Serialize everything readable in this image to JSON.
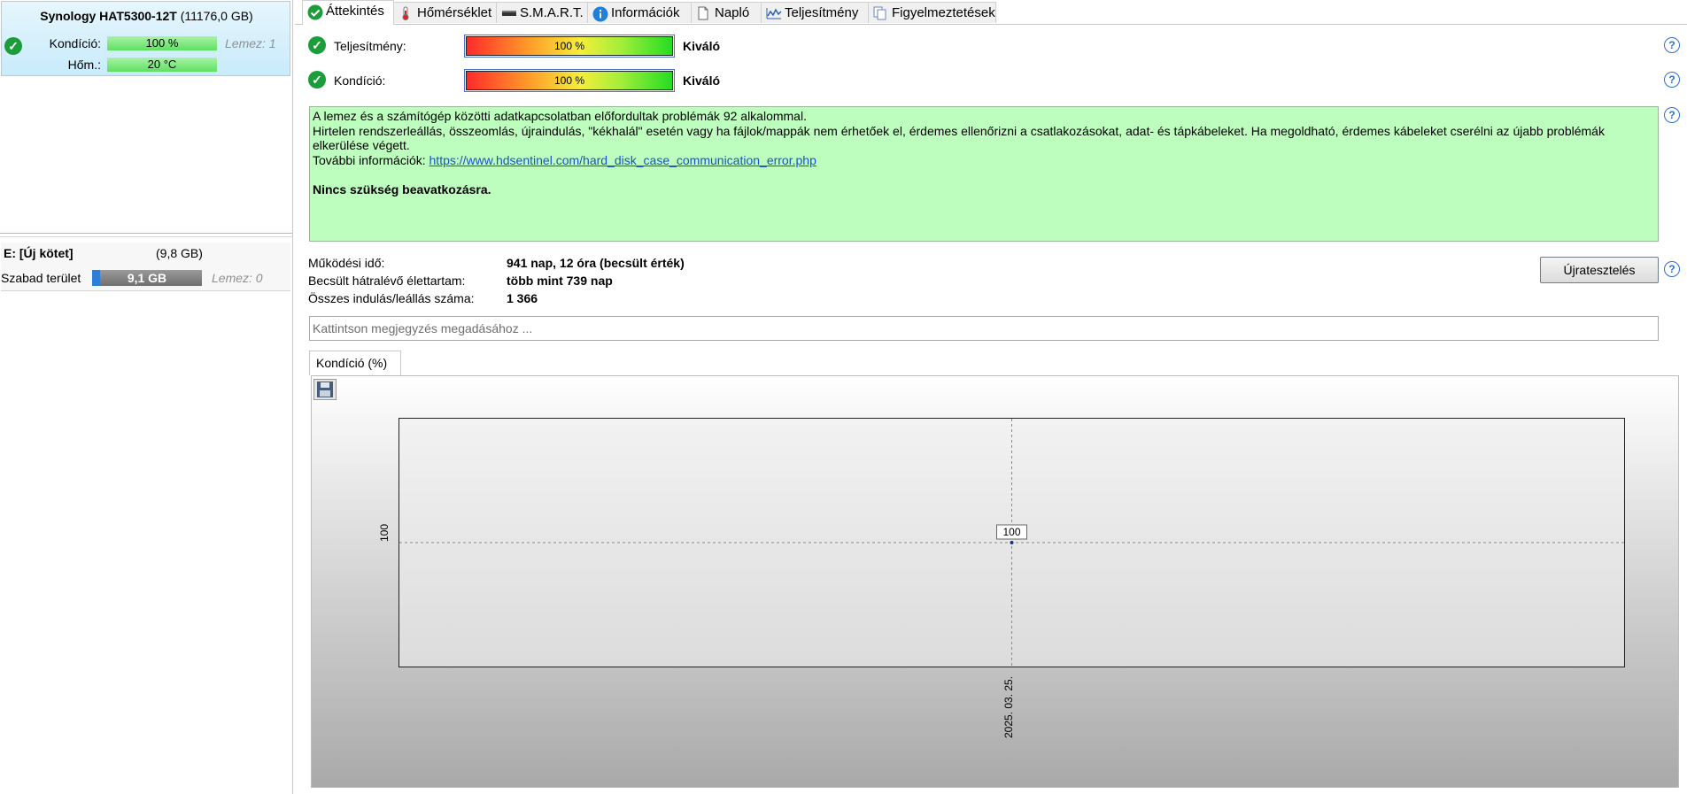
{
  "left_panel": {
    "disk_name": "Synology HAT5300-12T",
    "disk_size": "(11176,0 GB)",
    "condition_label": "Kondíció:",
    "condition_value": "100 %",
    "disk_index": "Lemez: 1",
    "temp_label": "Hőm.:",
    "temp_value": "20 °C",
    "volume_name": "E: [Új kötet]",
    "volume_size": "(9,8 GB)",
    "free_label": "Szabad terület",
    "free_value": "9,1 GB",
    "free_fraction": 0.07,
    "volume_disk": "Lemez: 0"
  },
  "tabs": [
    {
      "label": "Áttekintés",
      "icon": "check-circle-icon",
      "active": true
    },
    {
      "label": "Hőmérséklet",
      "icon": "thermometer-icon",
      "active": false
    },
    {
      "label": "S.M.A.R.T.",
      "icon": "disk-icon",
      "active": false
    },
    {
      "label": "Információk",
      "icon": "info-icon",
      "active": false
    },
    {
      "label": "Napló",
      "icon": "document-icon",
      "active": false
    },
    {
      "label": "Teljesítmény",
      "icon": "performance-chart-icon",
      "active": false
    },
    {
      "label": "Figyelmeztetések",
      "icon": "alerts-icon",
      "active": false
    }
  ],
  "status": {
    "performance_label": "Teljesítmény:",
    "performance_value": "100 %",
    "performance_rating": "Kiváló",
    "condition_label": "Kondíció:",
    "condition_value": "100 %",
    "condition_rating": "Kiváló"
  },
  "message": {
    "line1": "A lemez és a számítógép közötti adatkapcsolatban előfordultak problémák 92 alkalommal.",
    "line2": "Hirtelen rendszerleállás, összeomlás, újraindulás, \"kékhalál\" esetén vagy ha fájlok/mappák nem érhetőek el, érdemes ellenőrizni a csatlakozásokat, adat- és tápkábeleket. Ha megoldható, érdemes kábeleket cserélni az újabb problémák elkerülése végett.",
    "more_info_label": "További információk:",
    "more_info_link": "https://www.hdsentinel.com/hard_disk_case_communication_error.php",
    "conclusion": "Nincs szükség beavatkozásra."
  },
  "info": {
    "uptime_label": "Működési idő:",
    "uptime_value": "941 nap, 12 óra (becsült érték)",
    "lifetime_label": "Becsült hátralévő élettartam:",
    "lifetime_value": "több mint 739 nap",
    "starts_label": "Összes indulás/leállás száma:",
    "starts_value": "1 366",
    "retest_button": "Újratesztelés"
  },
  "note": {
    "placeholder": "Kattintson megjegyzés megadásához ..."
  },
  "chart_tab_label": "Kondíció  (%)",
  "chart_data": {
    "type": "line",
    "x": [
      "2025. 03. 25."
    ],
    "series": [
      {
        "values": [
          100
        ]
      }
    ],
    "ytick_labels": [
      "100"
    ],
    "data_labels": [
      "100"
    ],
    "grid": true
  },
  "colors": {
    "ok_green": "#1b9e3a",
    "message_bg": "#bdfdbd",
    "link": "#1a52c8",
    "help_blue": "#2c6fd6"
  }
}
